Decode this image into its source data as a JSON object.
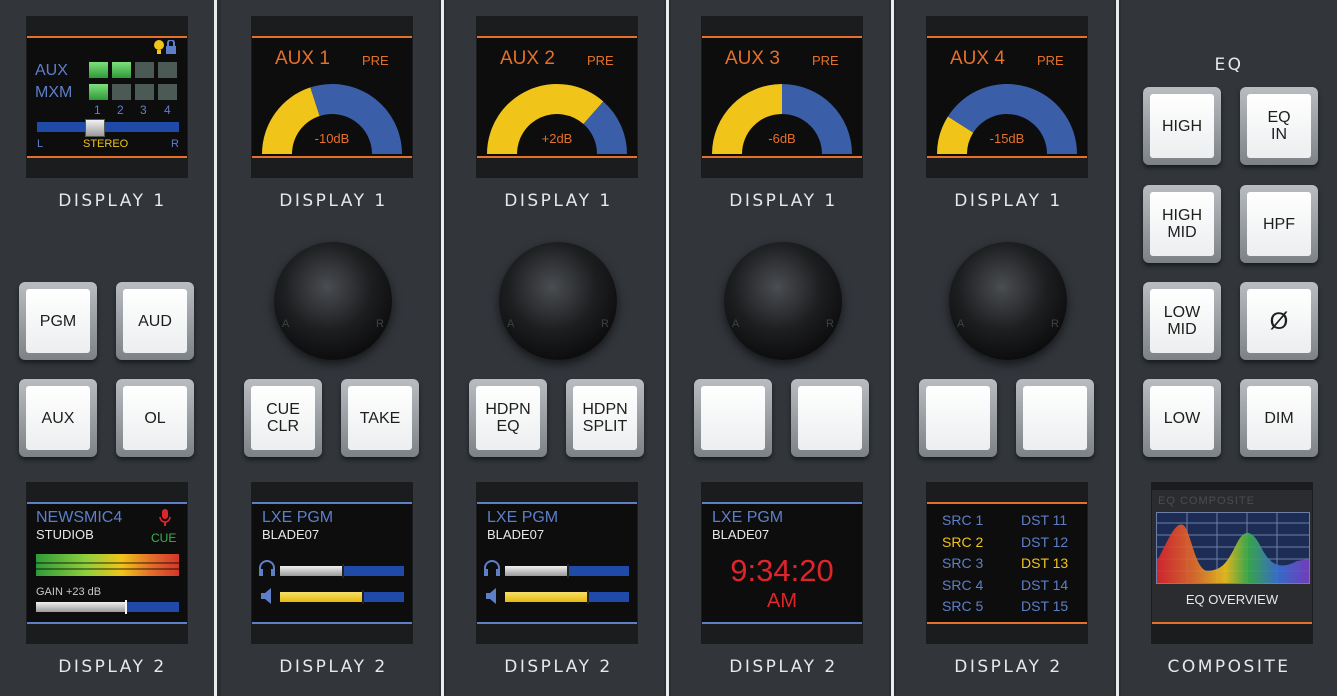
{
  "strips": [
    {
      "display1": {
        "type": "aux_mxm",
        "row_labels": [
          "AUX",
          "MXM"
        ],
        "columns": [
          "1",
          "2",
          "3",
          "4"
        ],
        "pan_left": "L",
        "pan_center": "STEREO",
        "pan_right": "R",
        "pan_position": 0.42,
        "icons": [
          "bulb-icon",
          "lock-icon"
        ]
      },
      "display1_caption": "DISPLAY 1",
      "buttons": [
        "PGM",
        "AUD",
        "AUX",
        "OL"
      ],
      "display2": {
        "type": "mic",
        "name": "NEWSMIC4",
        "location": "STUDIOB",
        "cue": "CUE",
        "gain": "GAIN +23 dB",
        "gain_level": 0.62
      },
      "display2_caption": "DISPLAY 2"
    },
    {
      "display1": {
        "type": "aux",
        "label": "AUX 1",
        "mode": "PRE",
        "value": "-10dB",
        "level": 0.4
      },
      "display1_caption": "DISPLAY 1",
      "knob_left": "A",
      "knob_right": "R",
      "buttons": [
        "CUE\nCLR",
        "TAKE"
      ],
      "display2": {
        "type": "source",
        "name": "LXE PGM",
        "sub": "BLADE07",
        "headphone_level": 0.5,
        "speaker_level": 0.66
      },
      "display2_caption": "DISPLAY 2"
    },
    {
      "display1": {
        "type": "aux",
        "label": "AUX 2",
        "mode": "PRE",
        "value": "+2dB",
        "level": 0.73
      },
      "display1_caption": "DISPLAY 1",
      "knob_left": "A",
      "knob_right": "R",
      "buttons": [
        "HDPN\nEQ",
        "HDPN\nSPLIT"
      ],
      "display2": {
        "type": "source",
        "name": "LXE PGM",
        "sub": "BLADE07",
        "headphone_level": 0.5,
        "speaker_level": 0.66
      },
      "display2_caption": "DISPLAY 2"
    },
    {
      "display1": {
        "type": "aux",
        "label": "AUX 3",
        "mode": "PRE",
        "value": "-6dB",
        "level": 0.5
      },
      "display1_caption": "DISPLAY 1",
      "knob_left": "A",
      "knob_right": "R",
      "buttons": [
        "",
        ""
      ],
      "display2": {
        "type": "clock",
        "name": "LXE PGM",
        "sub": "BLADE07",
        "time": "9:34:20",
        "ampm": "AM"
      },
      "display2_caption": "DISPLAY 2"
    },
    {
      "display1": {
        "type": "aux",
        "label": "AUX 4",
        "mode": "PRE",
        "value": "-15dB",
        "level": 0.18
      },
      "display1_caption": "DISPLAY 1",
      "knob_left": "A",
      "knob_right": "R",
      "buttons": [
        "",
        ""
      ],
      "display2": {
        "type": "routing",
        "rows": [
          [
            "SRC 1",
            "DST 11"
          ],
          [
            "SRC 2",
            "DST 12"
          ],
          [
            "SRC 3",
            "DST 13"
          ],
          [
            "SRC 4",
            "DST 14"
          ],
          [
            "SRC 5",
            "DST 15"
          ]
        ],
        "highlight_src": 1,
        "highlight_dst": 2
      },
      "display2_caption": "DISPLAY 2"
    }
  ],
  "eq_panel": {
    "title": "EQ",
    "buttons": [
      "HIGH",
      "EQ\nIN",
      "HIGH\nMID",
      "HPF",
      "LOW\nMID",
      "Ø",
      "LOW",
      "DIM"
    ],
    "composite": {
      "header": "EQ COMPOSITE",
      "footer": "EQ  OVERVIEW"
    },
    "caption": "COMPOSITE"
  },
  "colors": {
    "orange": "#e4702a",
    "blue_text": "#5e7fc8",
    "yellow": "#f0c419",
    "bar_blue": "#1f4aa8",
    "clock_red": "#e0242a",
    "meter_green": "#3ab14a"
  }
}
